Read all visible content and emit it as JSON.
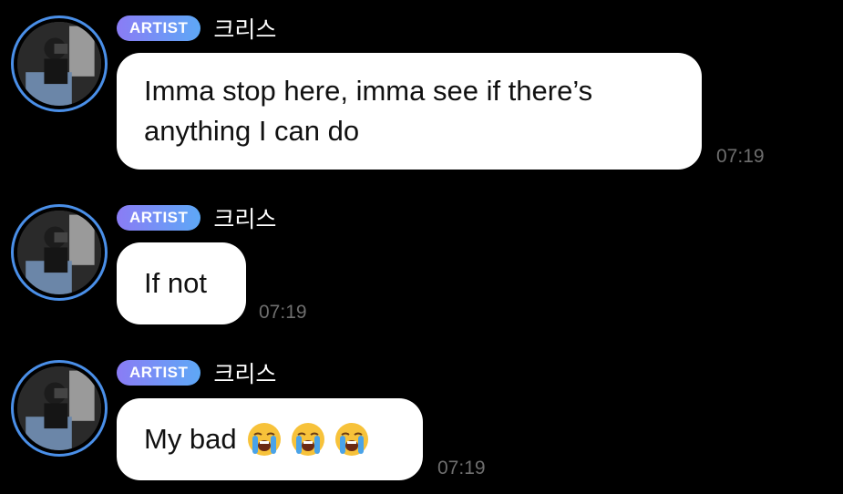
{
  "messages": [
    {
      "badge": "ARTIST",
      "name": "크리스",
      "text": "Imma stop here, imma see if there’s anything I can do",
      "time": "07:19"
    },
    {
      "badge": "ARTIST",
      "name": "크리스",
      "text": "If not",
      "time": "07:19"
    },
    {
      "badge": "ARTIST",
      "name": "크리스",
      "text": "My bad",
      "emojis": [
        "loudly-crying-face-icon",
        "loudly-crying-face-icon",
        "loudly-crying-face-icon"
      ],
      "time": "07:19"
    }
  ],
  "colors": {
    "background": "#000000",
    "bubble": "#ffffff",
    "avatar_ring": "#4a8fe8",
    "badge_start": "#8a7cf5",
    "badge_end": "#5ea8f6",
    "timestamp": "#6e6e6e"
  }
}
